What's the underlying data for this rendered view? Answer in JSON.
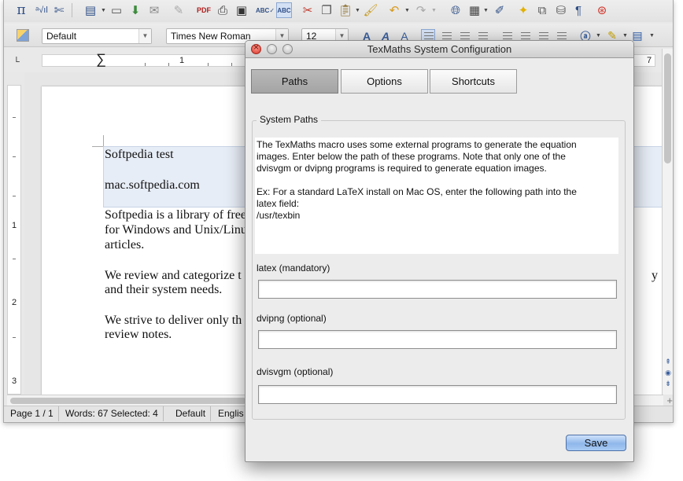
{
  "writer": {
    "paragraph_style": "Default",
    "font_name": "Times New Roman",
    "font_size": "12",
    "ruler_left_number": "1",
    "ruler_right_number": "7",
    "vertical_ruler_numbers": [
      "1",
      "2",
      "3"
    ],
    "document_lines": [
      "Softpedia test",
      "mac.softpedia.com",
      "Softpedia is a library of free",
      "for Windows and Unix/Linu",
      "articles.",
      "We review and categorize t",
      "and their system needs.",
      "We strive to deliver only th",
      "review notes."
    ],
    "right_edge_fragment": "y",
    "status": {
      "page": "Page 1 / 1",
      "words": "Words: 67 Selected: 4",
      "style": "Default",
      "language": "Englis"
    },
    "toolbar_icons": [
      "pi-icon",
      "math-icon",
      "scissors-icon",
      "new-document-icon",
      "open-folder-icon",
      "save-icon",
      "mail-icon",
      "edit-icon",
      "pdf-icon",
      "print-icon",
      "print-preview-icon",
      "spellcheck-icon",
      "autospell-icon",
      "cut-icon",
      "copy-icon",
      "paste-icon",
      "format-paintbrush-icon",
      "undo-icon",
      "redo-icon",
      "hyperlink-icon",
      "table-icon",
      "draw-icon",
      "navigator-icon",
      "gallery-icon",
      "datasource-icon",
      "pilcrow-icon",
      "help-icon"
    ]
  },
  "dialog": {
    "title": "TexMaths System Configuration",
    "tabs": [
      {
        "label": "Paths",
        "active": true
      },
      {
        "label": "Options",
        "active": false
      },
      {
        "label": "Shortcuts",
        "active": false
      }
    ],
    "group_title": "System Paths",
    "info_lines": [
      "The TexMaths macro uses some external programs to generate the equation",
      "images. Enter below the path of these programs. Note that only one of the",
      "dvisvgm or dvipng programs is required to generate equation images.",
      "",
      "Ex: For a standard LaTeX install on Mac OS, enter the following path into the",
      "latex field:",
      "/usr/texbin"
    ],
    "fields": [
      {
        "label": "latex (mandatory)",
        "value": ""
      },
      {
        "label": "dvipng (optional)",
        "value": ""
      },
      {
        "label": "dvisvgm (optional)",
        "value": ""
      }
    ],
    "save_label": "Save",
    "save_color": "#8fb7ea"
  }
}
